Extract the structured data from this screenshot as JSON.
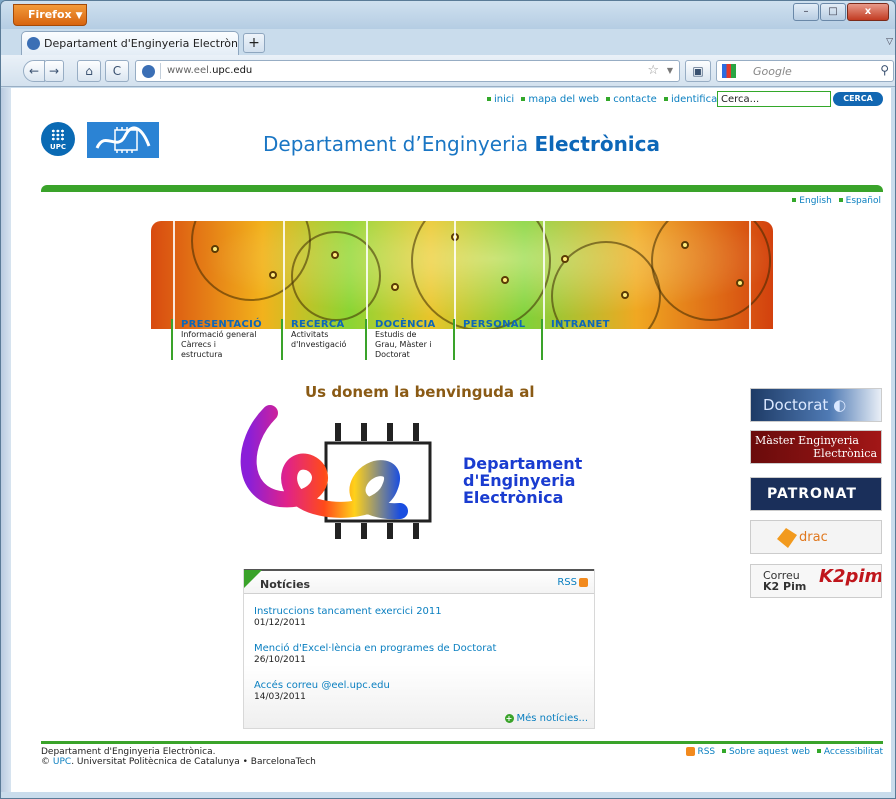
{
  "browser": {
    "menu_label": "Firefox",
    "tab_title": "Departament d'Enginyeria Electrònica —...",
    "new_tab": "+",
    "url_prefix": "www.eel.",
    "url_domain": "upc.edu",
    "search_engine": "Google",
    "window_controls": {
      "minimize": "–",
      "maximize": "□",
      "close": "x"
    }
  },
  "site": {
    "top_links": [
      "inici",
      "mapa del web",
      "contacte",
      "identifica't"
    ],
    "search_placeholder": "Cerca...",
    "search_button": "CERCA",
    "logo_upc_text": "UPC",
    "title_light": "Departament d’Enginyeria ",
    "title_bold": "Electrònica",
    "languages": [
      "English",
      "Español"
    ]
  },
  "nav": [
    {
      "label": "PRESENTACIÓ",
      "sub": [
        "Informació general",
        "Càrrecs i",
        "estructura"
      ]
    },
    {
      "label": "RECERCA",
      "sub": [
        "Activitats",
        "d'Investigació"
      ]
    },
    {
      "label": "DOCÈNCIA",
      "sub": [
        "Estudis de",
        "Grau, Màster i",
        "Doctorat"
      ]
    },
    {
      "label": "PERSONAL",
      "sub": []
    },
    {
      "label": "INTRANET",
      "sub": []
    }
  ],
  "welcome": {
    "heading": "Us donem la benvinguda al",
    "dept_line1": "Departament",
    "dept_line2": "d'Enginyeria",
    "dept_line3": "Electrònica"
  },
  "news": {
    "title": "Notícies",
    "rss": "RSS",
    "items": [
      {
        "title": "Instruccions tancament exercici 2011",
        "date": "01/12/2011"
      },
      {
        "title": "Menció d'Excel·lència en programes de Doctorat",
        "date": "26/10/2011"
      },
      {
        "title": "Accés correu @eel.upc.edu",
        "date": "14/03/2011"
      }
    ],
    "more": "Més notícies..."
  },
  "side_buttons": {
    "doctorat": "Doctorat",
    "master_l1": "Màster Enginyeria",
    "master_l2": "Electrònica",
    "patronat": "PATRONAT",
    "drac": "drac",
    "k2_l1": "Correu",
    "k2_l2": "K2 Pim",
    "k2_logo": "K2pim"
  },
  "footer": {
    "line1": "Departament d'Enginyeria Electrònica.",
    "copy": "©",
    "upc": "UPC",
    "line2_rest": ". Universitat Politècnica de Catalunya • BarcelonaTech",
    "links": [
      "RSS",
      "Sobre aquest web",
      "Accessibilitat"
    ]
  },
  "colors": {
    "accent_green": "#3aa32a",
    "link_blue": "#0a7fc0",
    "title_blue": "#1a76c4",
    "welcome_brown": "#8a5a14"
  }
}
